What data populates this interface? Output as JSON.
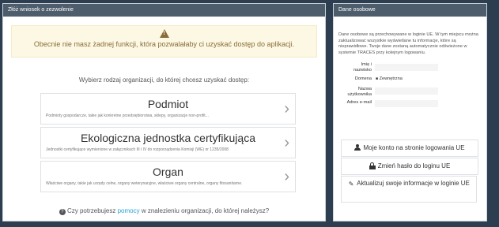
{
  "left_panel": {
    "title": "Złóż wniosek o zezwolenie",
    "alert": {
      "icon": "warning-icon",
      "text": "Obecnie nie masz żadnej funkcji, która pozwalałaby ci uzyskać dostęp do aplikacji."
    },
    "choose_text": "Wybierz rodzaj organizacji, do której chcesz uzyskać dostęp:",
    "options": [
      {
        "title": "Podmiot",
        "desc": "Podmioty gospodarcze, takie jak konkretne przedsiębiorstwa, sklepy, organizacje non-profit..."
      },
      {
        "title": "Ekologiczna jednostka certyfikująca",
        "desc": "Jednostki certyfikujące wymienione w załącznikach III i IV do rozporządzenia Komisji (WE) nr 1235/2008"
      },
      {
        "title": "Organ",
        "desc": "Właściwe organy, takie jak urzędy celne, organy weterynaryjne, właściwe organy centralne, organy fitosanitarne."
      }
    ],
    "help": {
      "before": "Czy potrzebujesz ",
      "link": "pomocy",
      "after": " w znalezieniu organizacji, do której należysz?"
    }
  },
  "right_panel": {
    "title": "Dane osobowe",
    "info": "Dane osobowe są przechowywane w loginie UE. W tym miejscu można zaktualizować wszystkie wyświetlane tu informacje, które są nieprawidłowe. Twoje dane zostaną automatycznie odświeżone w systemie TRACES przy kolejnym logowaniu.",
    "fields": {
      "name_label_1": "Imię i",
      "name_label_2": "nazwisko",
      "domain_label": "Domena",
      "domain_value": "Zewnętrzna",
      "user_label_1": "Nazwa",
      "user_label_2": "użytkownika",
      "email_label": "Adres e-mail"
    },
    "buttons": {
      "account": "Moje konto na stronie logowania UE",
      "password": "Zmień hasło do loginu UE",
      "update": "Aktualizuj swoje informacje w loginie UE"
    }
  }
}
